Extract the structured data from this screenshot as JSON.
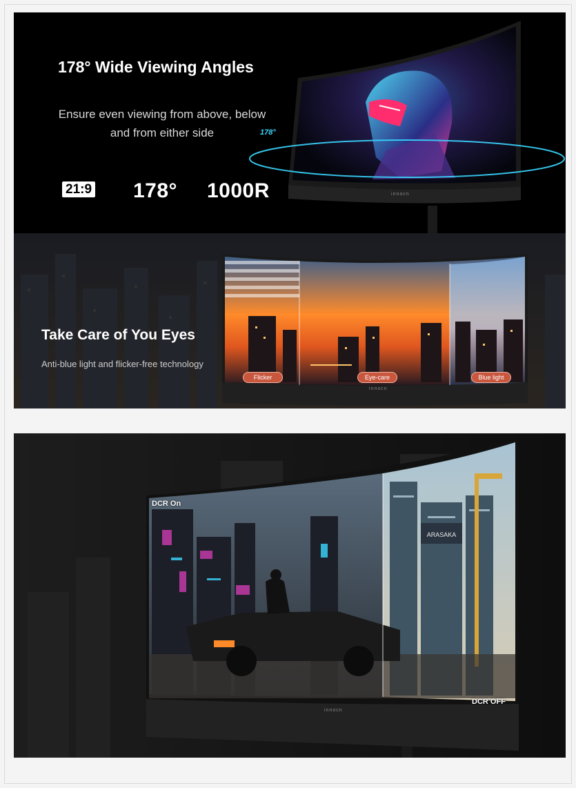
{
  "section_viewing": {
    "title": "178° Wide Viewing Angles",
    "body_line1": "Ensure even viewing from above, below",
    "body_line2": "and from either side",
    "angle_label": "178°",
    "specs": {
      "aspect_ratio": "21:9",
      "viewing_angle": "178°",
      "curvature": "1000R"
    },
    "brand": "innocn"
  },
  "section_eyecare": {
    "title": "Take Care of You Eyes",
    "subtitle": "Anti-blue light and flicker-free technology",
    "labels": [
      "Flicker",
      "Eye-care",
      "Blue light"
    ],
    "brand": "innocn"
  },
  "section_dcr": {
    "label_on": "DCR On",
    "label_off": "DCR OFF",
    "brand": "innocn",
    "sign_text": "ARASAKA"
  },
  "colors": {
    "neon_cyan": "#3ad7ff",
    "neon_pink": "#ff3d9e",
    "sunset": "#ff8a2a",
    "pill": "#c9573e"
  },
  "icons": [
    "monitor-curved-icon",
    "orbit-ring-icon"
  ]
}
